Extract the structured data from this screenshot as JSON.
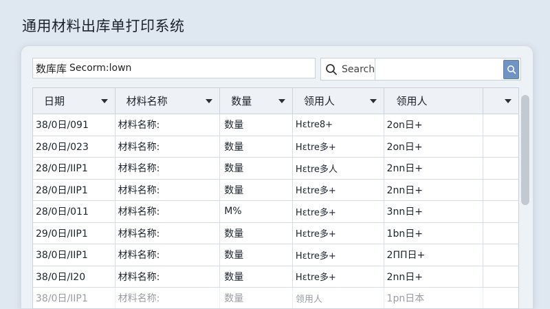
{
  "app": {
    "title": "通用材料出库单打印系统"
  },
  "search": {
    "left_label": "数库库",
    "left_value": "Secorm:lown",
    "placeholder": "Search",
    "value": ""
  },
  "table": {
    "headers": [
      "日期",
      "材料名称",
      "数量",
      "领用人",
      "领用人"
    ],
    "rows": [
      [
        "38/0日/091",
        "材料名称:",
        "数量",
        "Hεtre8+",
        "2on日+"
      ],
      [
        "28/0日/023",
        "材料名称:",
        "数量",
        "Hεtre多+",
        "2on日+"
      ],
      [
        "28/0日/ⅠⅠP1",
        "材料名称:",
        "数量",
        "Hεtre多人",
        "2nn日+"
      ],
      [
        "28/0日/ⅠⅠP1",
        "材料名称:",
        "数量",
        "Hεtre多+",
        "2nn日+"
      ],
      [
        "28/0日/011",
        "材料名称:",
        "M%",
        "Hεtre多+",
        "3nn日+"
      ],
      [
        "29/0日/ⅠⅠP1",
        "材料名称:",
        "数量",
        "Hεtre多+",
        "1bn日+"
      ],
      [
        "38/0日/ⅠⅠP1",
        "材料名称:",
        "数量",
        "Hεtre多+",
        "2ΠΠ日+"
      ],
      [
        "38/0日/Ⅰ20",
        "材料名称:",
        "数量",
        "Hεtre多+",
        "2nn日+"
      ],
      [
        "38/0日/ⅠⅠP1",
        "材料名称:",
        "数量",
        "领用人",
        "1pn日本"
      ]
    ]
  },
  "colors": {
    "accent": "#6f93c2",
    "panel": "#edf2f7",
    "background": "#dfe7f0"
  }
}
